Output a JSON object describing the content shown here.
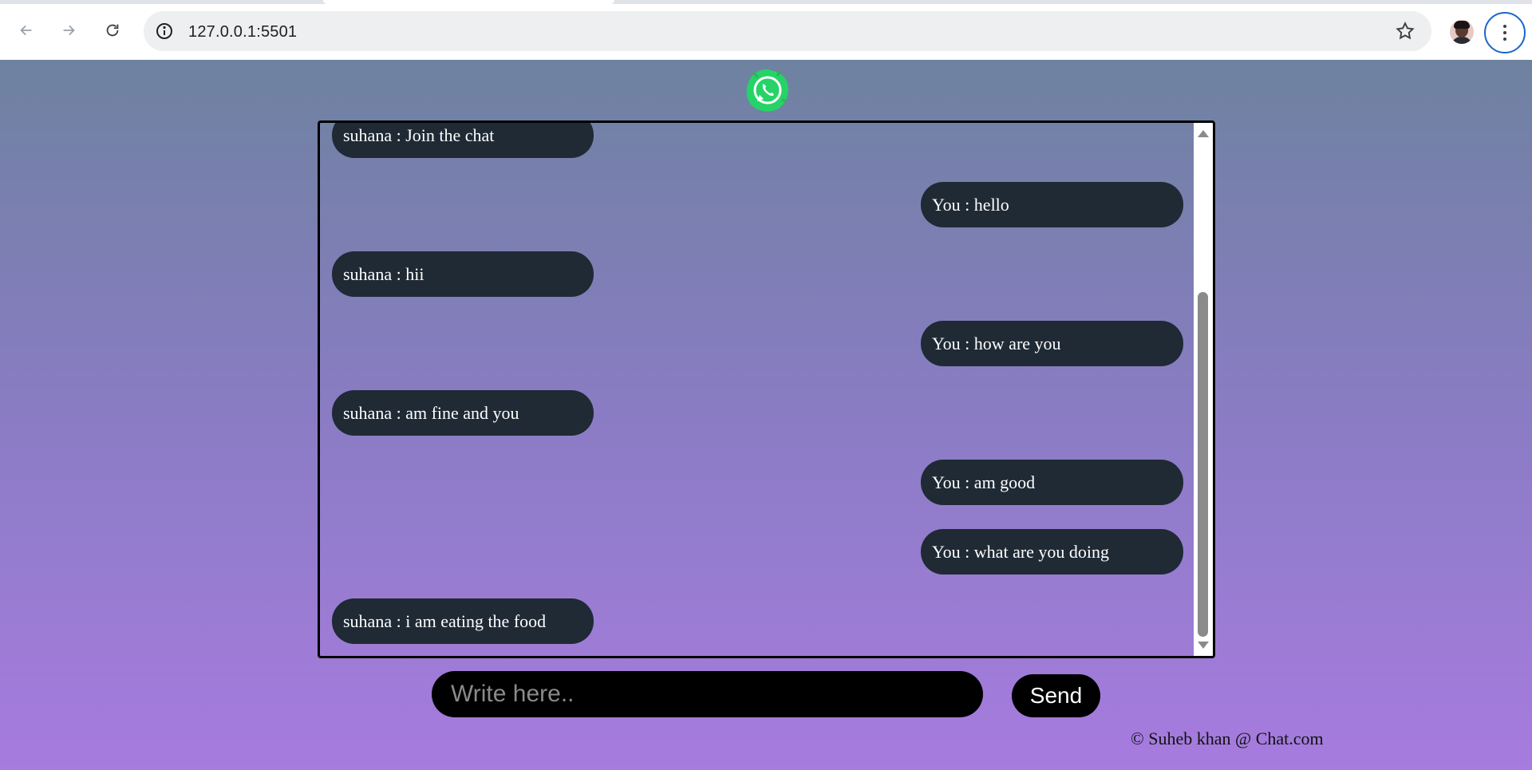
{
  "browser": {
    "url": "127.0.0.1:5501"
  },
  "page": {
    "logo": "whatsapp-logo",
    "messages": [
      {
        "side": "left",
        "text": "suhana : Join the chat"
      },
      {
        "side": "right",
        "text": "You : hello"
      },
      {
        "side": "left",
        "text": "suhana : hii"
      },
      {
        "side": "right",
        "text": "You : how are you"
      },
      {
        "side": "left",
        "text": "suhana : am fine and you"
      },
      {
        "side": "right",
        "text": "You : am good"
      },
      {
        "side": "right",
        "text": "You : what are you doing"
      },
      {
        "side": "left",
        "text": "suhana : i am eating the food"
      }
    ],
    "input_placeholder": "Write here..",
    "input_value": "",
    "send_label": "Send",
    "footer": "© Suheb khan @ Chat.com"
  },
  "colors": {
    "bubble": "#1f2a35",
    "gradient_top": "#6e82a0",
    "gradient_bottom": "#a77bdf",
    "accent_focus": "#1a66c9",
    "whatsapp_green": "#25d366"
  }
}
